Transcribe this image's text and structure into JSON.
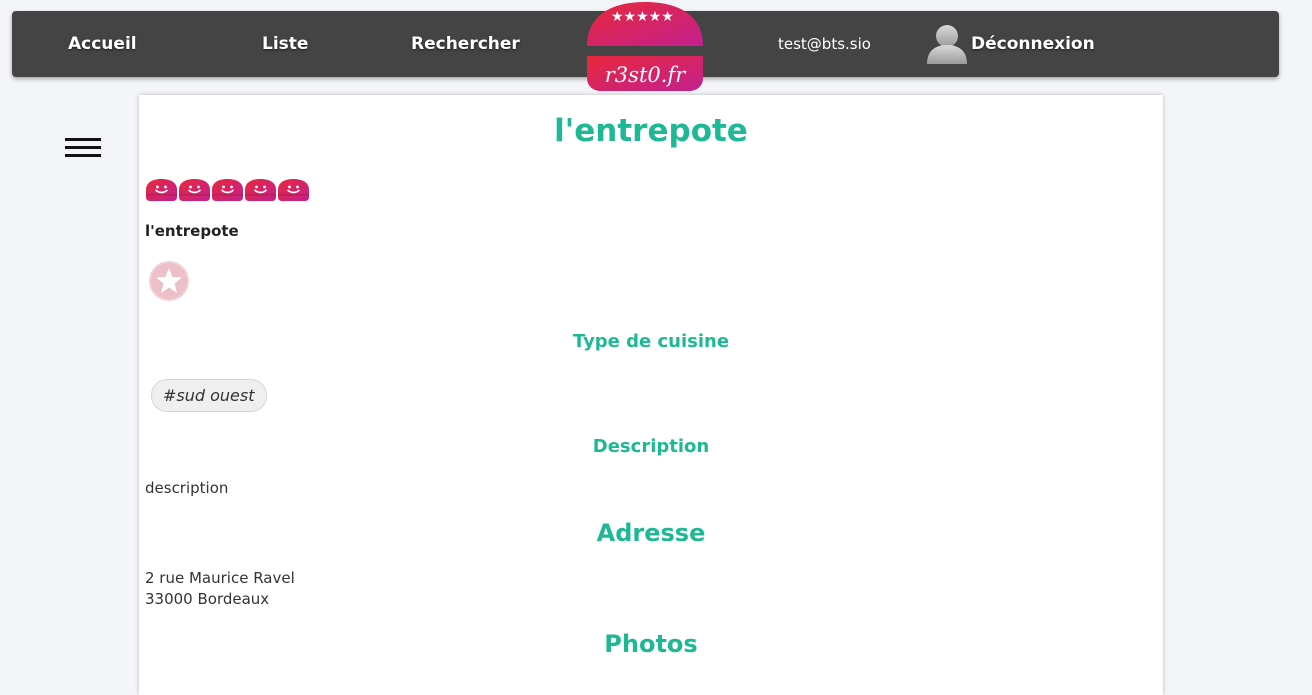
{
  "nav": {
    "home_label": "Accueil",
    "list_label": "Liste",
    "search_label": "Rechercher",
    "logo_text": "r3st0.fr",
    "user_email": "test@bts.sio",
    "logout_label": "Déconnexion"
  },
  "restaurant": {
    "title": "l'entrepote",
    "name": "l'entrepote",
    "rating": 5,
    "rating_max": 5,
    "cuisine_heading": "Type de cuisine",
    "cuisine_tag": "#sud ouest",
    "description_heading": "Description",
    "description": "description",
    "address_heading": "Adresse",
    "address_line1": "2 rue Maurice Ravel",
    "address_line2": "33000 Bordeaux",
    "photos_heading": "Photos"
  },
  "colors": {
    "accent": "#1fb894",
    "navbar": "#444444",
    "logo_gradient_start": "#e8283a",
    "logo_gradient_end": "#c3208f"
  },
  "icons": {
    "menu": "hamburger-icon",
    "user": "user-silhouette-icon",
    "favorite": "star-icon",
    "rating": "smiley-icon"
  }
}
